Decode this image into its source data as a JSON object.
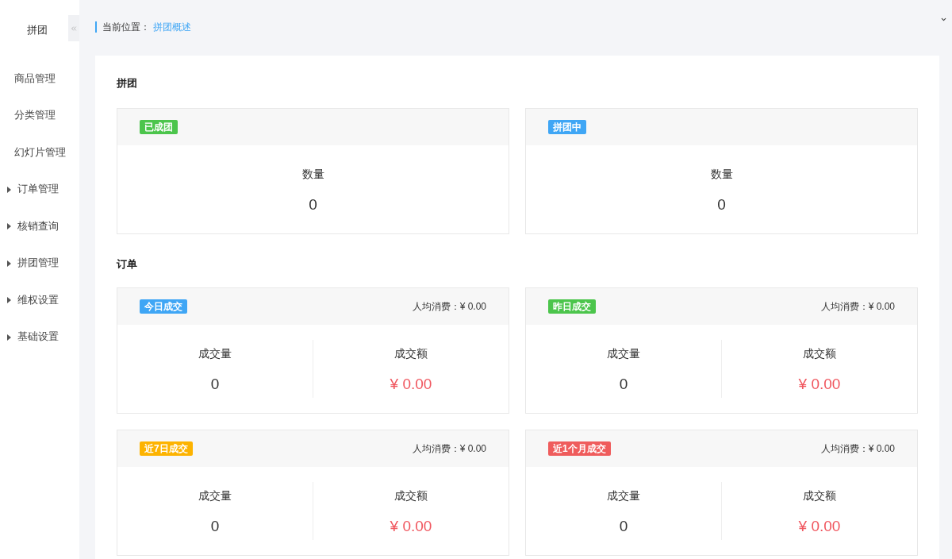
{
  "sidebar": {
    "title": "拼团",
    "items": [
      {
        "label": "商品管理",
        "kind": "link"
      },
      {
        "label": "分类管理",
        "kind": "link"
      },
      {
        "label": "幻灯片管理",
        "kind": "link"
      },
      {
        "label": "订单管理",
        "kind": "group"
      },
      {
        "label": "核销查询",
        "kind": "group"
      },
      {
        "label": "拼团管理",
        "kind": "group"
      },
      {
        "label": "维权设置",
        "kind": "group"
      },
      {
        "label": "基础设置",
        "kind": "group"
      }
    ]
  },
  "breadcrumb": {
    "label": "当前位置：",
    "current": "拼团概述"
  },
  "group_section": {
    "title": "拼团",
    "cards": [
      {
        "badge": "已成团",
        "color": "#4cc54c",
        "metric_label": "数量",
        "metric_value": "0"
      },
      {
        "badge": "拼团中",
        "color": "#3fa6f5",
        "metric_label": "数量",
        "metric_value": "0"
      }
    ]
  },
  "order_section": {
    "title": "订单",
    "cards": [
      {
        "badge": "今日成交",
        "color": "#3fa6f5",
        "avg": "人均消费：¥ 0.00",
        "volume_label": "成交量",
        "volume": "0",
        "amount_label": "成交额",
        "amount": "¥ 0.00"
      },
      {
        "badge": "昨日成交",
        "color": "#4cc54c",
        "avg": "人均消费：¥ 0.00",
        "volume_label": "成交量",
        "volume": "0",
        "amount_label": "成交额",
        "amount": "¥ 0.00"
      },
      {
        "badge": "近7日成交",
        "color": "#fdb300",
        "avg": "人均消费：¥ 0.00",
        "volume_label": "成交量",
        "volume": "0",
        "amount_label": "成交额",
        "amount": "¥ 0.00"
      },
      {
        "badge": "近1个月成交",
        "color": "#ef5c5c",
        "avg": "人均消费：¥ 0.00",
        "volume_label": "成交量",
        "volume": "0",
        "amount_label": "成交额",
        "amount": "¥ 0.00"
      }
    ]
  }
}
